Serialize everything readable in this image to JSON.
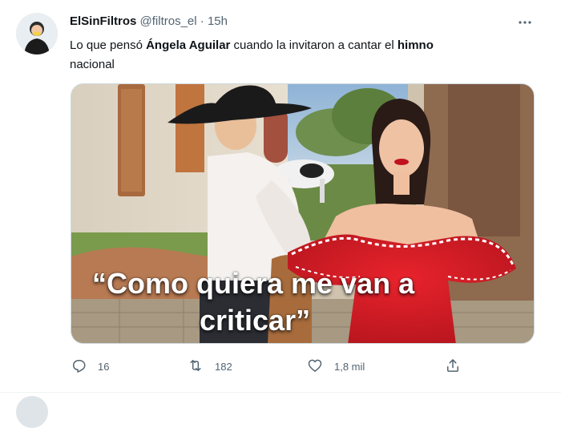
{
  "tweet": {
    "display_name": "ElSinFiltros",
    "handle": "@filtros_el",
    "separator": "·",
    "time": "15h",
    "text": {
      "t1": "Lo que pensó ",
      "b1": "Ángela Aguilar",
      "t2": " cuando la invitaron a cantar el ",
      "b2": "himno",
      "t3": " nacional"
    },
    "media": {
      "caption_line1": "“Como quiera me van a",
      "caption_line2": "criticar”"
    },
    "actions": {
      "reply_count": "16",
      "retweet_count": "182",
      "like_count": "1,8 mil"
    }
  },
  "icons": {
    "more": "more-dots-icon",
    "reply": "reply-icon",
    "retweet": "retweet-icon",
    "like": "heart-icon",
    "share": "share-icon"
  },
  "colors": {
    "text": "#0f1419",
    "secondary": "#536471",
    "border": "#cfd9de"
  }
}
